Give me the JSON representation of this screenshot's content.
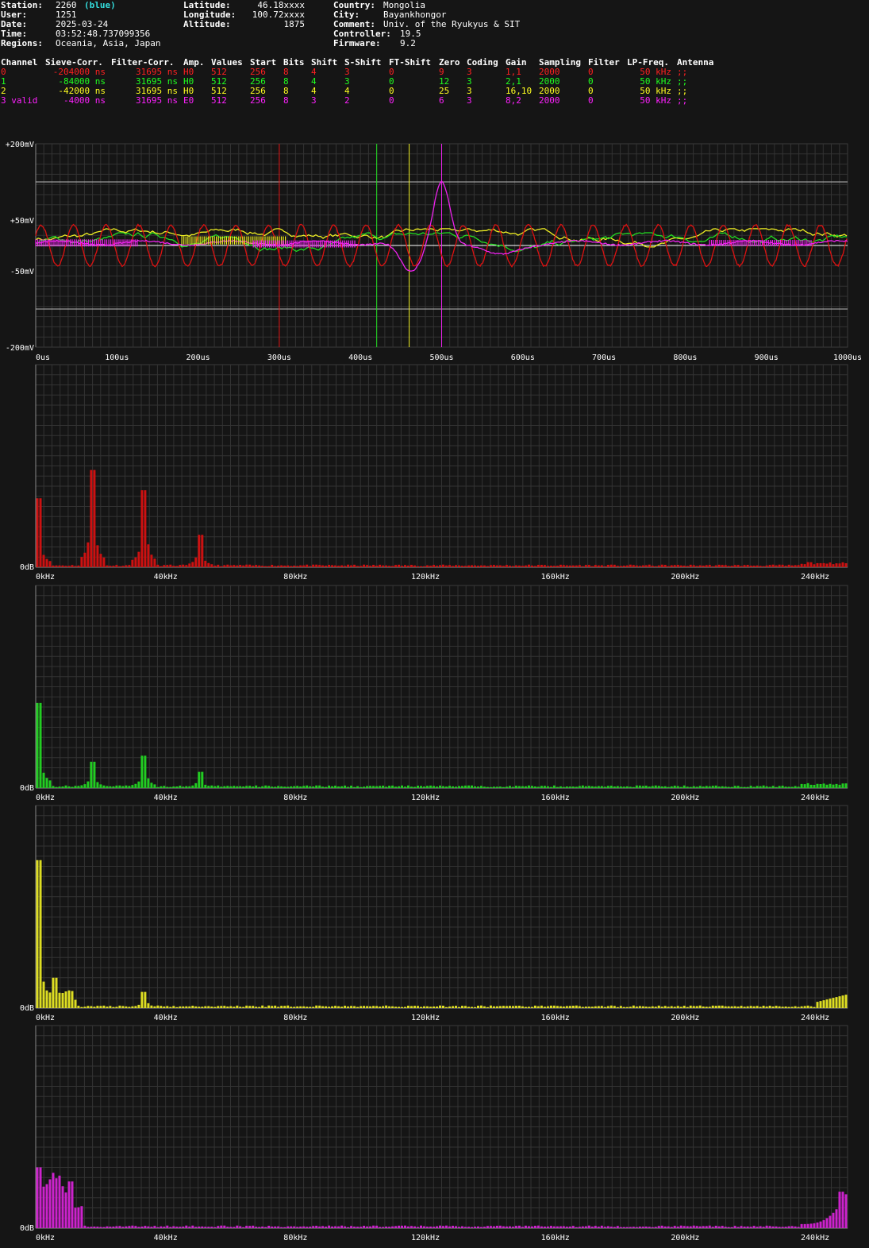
{
  "header": {
    "col1": [
      {
        "label": "Station:",
        "value": "2260",
        "extra": "(blue)"
      },
      {
        "label": "User:",
        "value": "1251"
      },
      {
        "label": "Date:",
        "value": "2025-03-24"
      },
      {
        "label": "Time:",
        "value": "03:52:48.737099356"
      },
      {
        "label": "Regions:",
        "value": "Oceania, Asia, Japan"
      }
    ],
    "col2": [
      {
        "label": "Latitude:",
        "value": "46.18xxxx"
      },
      {
        "label": "Longitude:",
        "value": "100.72xxxx"
      },
      {
        "label": "Altitude:",
        "value": "1875"
      }
    ],
    "col3": [
      {
        "label": "Country:",
        "value": "Mongolia"
      },
      {
        "label": "City:",
        "value": "Bayankhongor"
      },
      {
        "label": "Comment:",
        "value": "Univ. of the Ryukyus & SIT"
      },
      {
        "label": "Controller:",
        "value": "19.5"
      },
      {
        "label": "Firmware:",
        "value": "9.2"
      }
    ]
  },
  "channel_table": {
    "headers": [
      "Channel",
      "Sieve-Corr.",
      "Filter-Corr.",
      "Amp.",
      "Values",
      "Start",
      "Bits",
      "Shift",
      "S-Shift",
      "FT-Shift",
      "Zero",
      "Coding",
      "Gain",
      "Sampling",
      "Filter",
      "LP-Freq.",
      "Antenna"
    ],
    "rows": [
      [
        "0",
        "-204000 ns",
        "31695 ns",
        "H0",
        "512",
        "256",
        "8",
        "4",
        "3",
        "0",
        "9",
        "3",
        "1,1",
        "2000",
        "0",
        "50 kHz",
        ";;"
      ],
      [
        "1",
        "-84000 ns",
        "31695 ns",
        "H0",
        "512",
        "256",
        "8",
        "4",
        "3",
        "0",
        "12",
        "3",
        "2,1",
        "2000",
        "0",
        "50 kHz",
        ";;"
      ],
      [
        "2",
        "-42000 ns",
        "31695 ns",
        "H0",
        "512",
        "256",
        "8",
        "4",
        "4",
        "0",
        "25",
        "3",
        "16,10",
        "2000",
        "0",
        "50 kHz",
        ";;"
      ],
      [
        "3 valid",
        "-4000 ns",
        "31695 ns",
        "E0",
        "512",
        "256",
        "8",
        "3",
        "2",
        "0",
        "6",
        "3",
        "8,2",
        "2000",
        "0",
        "50 kHz",
        ";;"
      ]
    ],
    "colors": [
      "#ff2020",
      "#20ff20",
      "#ffff20",
      "#ff20ff"
    ]
  },
  "colors": {
    "bg": "#151515",
    "grid": "#3a3a3a",
    "red": "#dd1111",
    "green": "#22dd22",
    "yellow": "#eeee22",
    "magenta": "#ee22ee",
    "bars": [
      "#cc1111",
      "#22cc22",
      "#dddd22",
      "#cc22cc"
    ]
  },
  "chart_data": [
    {
      "type": "line",
      "xlabel_ticks": [
        "0us",
        "100us",
        "200us",
        "300us",
        "400us",
        "500us",
        "600us",
        "700us",
        "800us",
        "900us",
        "1000us"
      ],
      "ylabel_ticks": [
        "+200mV",
        "+50mV",
        "-50mV",
        "-200mV"
      ],
      "xlim": [
        0,
        1000
      ],
      "ylim": [
        -200,
        200
      ],
      "markers_us": {
        "red": 300,
        "green": 420,
        "yellow": 460,
        "magenta": 500
      },
      "series": [
        {
          "channel": "0",
          "color": "red",
          "shape": "oscillation",
          "amplitude_mV": 45,
          "period_us": 40
        },
        {
          "channel": "1",
          "color": "green",
          "shape": "noise",
          "amplitude_mV": 15
        },
        {
          "channel": "2",
          "color": "yellow",
          "shape": "noise",
          "amplitude_mV": 12
        },
        {
          "channel": "3",
          "color": "magenta",
          "shape": "pulse",
          "peak_us": 498,
          "peak_mV": 125,
          "dip_us": 460,
          "dip_mV": -60
        }
      ]
    },
    {
      "type": "bar",
      "channel": "0",
      "xlabel_ticks": [
        "0kHz",
        "40kHz",
        "80kHz",
        "120kHz",
        "160kHz",
        "200kHz",
        "240kHz"
      ],
      "ylabel": "0dB",
      "xlim": [
        0,
        250
      ],
      "peaks": [
        {
          "x": 0,
          "v": 0.34
        },
        {
          "x": 17,
          "v": 0.48
        },
        {
          "x": 33,
          "v": 0.38
        },
        {
          "x": 50,
          "v": 0.16
        }
      ]
    },
    {
      "type": "bar",
      "channel": "1",
      "xlabel_ticks": [
        "0kHz",
        "40kHz",
        "80kHz",
        "120kHz",
        "160kHz",
        "200kHz",
        "240kHz"
      ],
      "ylabel": "0dB",
      "xlim": [
        0,
        250
      ],
      "peaks": [
        {
          "x": 0,
          "v": 0.42
        },
        {
          "x": 17,
          "v": 0.13
        },
        {
          "x": 33,
          "v": 0.16
        },
        {
          "x": 50,
          "v": 0.08
        }
      ]
    },
    {
      "type": "bar",
      "channel": "2",
      "xlabel_ticks": [
        "0kHz",
        "40kHz",
        "80kHz",
        "120kHz",
        "160kHz",
        "200kHz",
        "240kHz"
      ],
      "ylabel": "0dB",
      "xlim": [
        0,
        250
      ],
      "peaks": [
        {
          "x": 0,
          "v": 0.73
        },
        {
          "x": 5,
          "v": 0.15
        },
        {
          "x": 33,
          "v": 0.08
        }
      ]
    },
    {
      "type": "bar",
      "channel": "3",
      "xlabel_ticks": [
        "0kHz",
        "40kHz",
        "80kHz",
        "120kHz",
        "160kHz",
        "200kHz",
        "240kHz"
      ],
      "ylabel": "0dB",
      "xlim": [
        0,
        250
      ],
      "peaks": [
        {
          "x": 0,
          "v": 0.3
        },
        {
          "x": 10,
          "v": 0.23
        },
        {
          "x": 248,
          "v": 0.18
        }
      ]
    }
  ]
}
